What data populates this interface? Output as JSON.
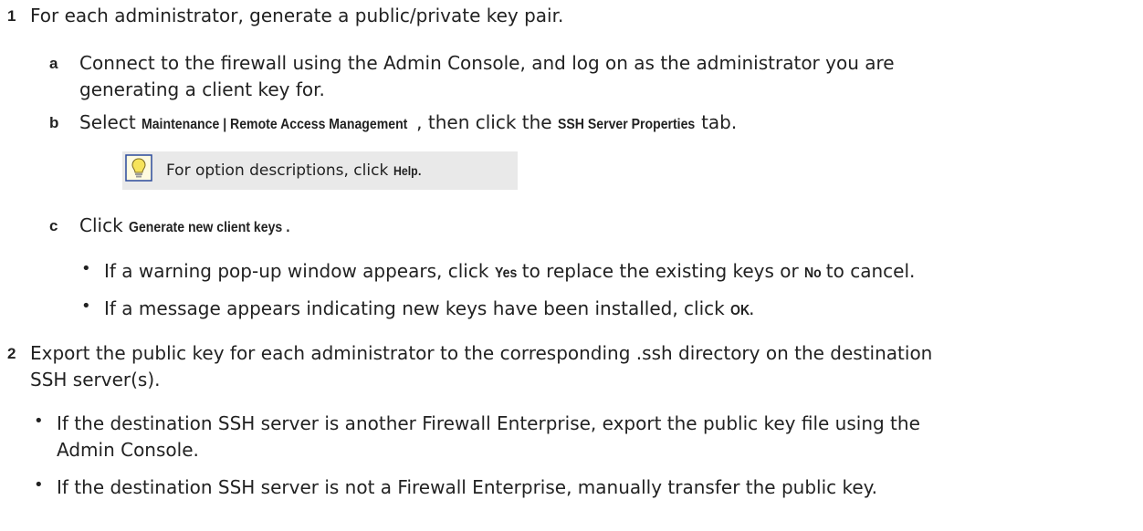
{
  "steps": [
    {
      "num": "1",
      "text": "For each administrator, generate a public/private key pair."
    },
    {
      "num": "2",
      "line1": "Export the public key for each administrator to the corresponding .ssh directory on the destination",
      "line2": "SSH server(s)."
    }
  ],
  "substeps": {
    "a": {
      "letter": "a",
      "line1": "Connect to the firewall using the Admin Console, and log on as the administrator you are",
      "line2": "generating a client key for."
    },
    "b": {
      "letter": "b",
      "pre": "Select ",
      "ui1": "Maintenance | Remote Access Management",
      "mid": ", then click the ",
      "ui2": "SSH Server Properties",
      "post": " tab."
    },
    "c": {
      "letter": "c",
      "pre": "Click ",
      "ui": "Generate new client keys",
      "post": "."
    }
  },
  "tip": {
    "pre": "For option descriptions, click ",
    "ui": "Help",
    "post": ".",
    "icon": "lightbulb-icon"
  },
  "c_bullets": [
    {
      "pre": "If a warning pop-up window appears, click ",
      "ui1": "Yes",
      "mid": " to replace the existing keys or ",
      "ui2": "No",
      "post": " to cancel."
    },
    {
      "pre": "If a message appears indicating new keys have been installed, click ",
      "ui": "OK",
      "post": "."
    }
  ],
  "step2_bullets": [
    {
      "line1": "If the destination SSH server is another Firewall Enterprise, export the public key file using the",
      "line2": "Admin Console."
    },
    {
      "line1": "If the destination SSH server is not a Firewall Enterprise, manually transfer the public key."
    }
  ],
  "bullet_char": "•"
}
